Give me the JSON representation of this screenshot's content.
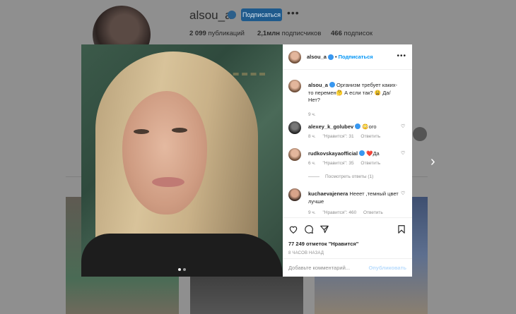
{
  "profile": {
    "username": "alsou_a",
    "follow_label": "Подписаться",
    "more": "•••",
    "posts_count": "2 099",
    "posts_label": "публикаций",
    "followers_count": "2,1млн",
    "followers_label": "подписчиков",
    "following_count": "466",
    "following_label": "подписок"
  },
  "post": {
    "author": "alsou_a",
    "separator": "•",
    "follow_label": "Подписаться",
    "options": "•••",
    "caption_author": "alsou_a",
    "caption_text": "Организм требует каких-то перемен🤔 А если так? 😩 Да/Нет?",
    "caption_time": "9 ч.",
    "likes": "77 249 отметок \"Нравится\"",
    "posted_ago": "8 ЧАСОВ НАЗАД",
    "comment_placeholder": "Добавьте комментарий...",
    "publish_label": "Опубликовать"
  },
  "comments": [
    {
      "user": "alexey_k_golubev",
      "text": "😳ого",
      "time": "8 ч.",
      "likes": "\"Нравится\": 31",
      "reply": "Ответить"
    },
    {
      "user": "rudkovskayaofficial",
      "text": "❤️Да",
      "time": "6 ч.",
      "likes": "\"Нравится\": 35",
      "reply": "Ответить"
    },
    {
      "user": "kuchaevajenera",
      "text": "Нееет ,темный цвет лучше",
      "time": "9 ч.",
      "likes": "\"Нравится\": 460",
      "reply": "Ответить"
    }
  ],
  "view_replies": "Посмотреть ответы (1)",
  "colors": {
    "accent": "#0095f6",
    "verified": "#3897f0",
    "overlay": "#8f8f8f"
  }
}
